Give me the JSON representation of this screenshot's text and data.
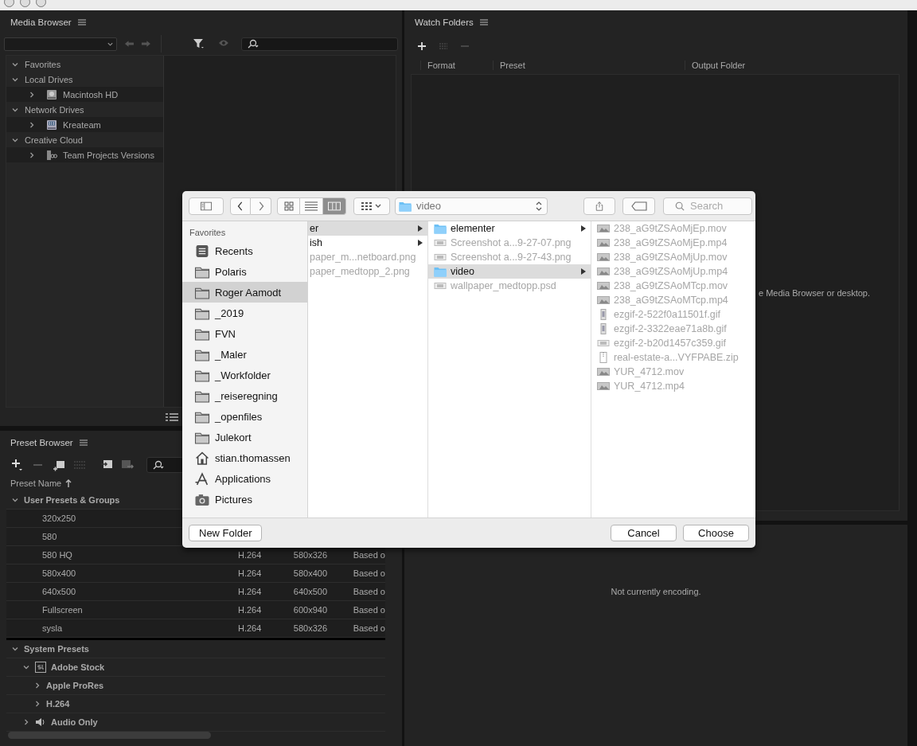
{
  "media_browser": {
    "title": "Media Browser",
    "tree": [
      {
        "label": "Favorites",
        "expanded": true
      },
      {
        "label": "Local Drives",
        "expanded": true,
        "children": [
          {
            "label": "Macintosh HD",
            "kind": "disk",
            "expanded": false
          }
        ]
      },
      {
        "label": "Network Drives",
        "expanded": true,
        "children": [
          {
            "label": "Kreateam",
            "kind": "network",
            "expanded": false
          }
        ]
      },
      {
        "label": "Creative Cloud",
        "expanded": true,
        "children": [
          {
            "label": "Team Projects Versions",
            "kind": "versions",
            "expanded": false
          }
        ]
      }
    ]
  },
  "preset_browser": {
    "title": "Preset Browser",
    "column": "Preset Name",
    "tree": [
      {
        "kind": "group",
        "label": "User Presets & Groups",
        "expanded": true,
        "children": [
          {
            "kind": "preset",
            "name": "320x250"
          },
          {
            "kind": "preset",
            "name": "580"
          },
          {
            "kind": "preset",
            "name": "580 HQ",
            "column_2": "H.264",
            "column_3": "580x326",
            "column_4": "Based o"
          },
          {
            "kind": "preset",
            "name": "580x400",
            "column_2": "H.264",
            "column_3": "580x400",
            "column_4": "Based o"
          },
          {
            "kind": "preset",
            "name": "640x500",
            "column_2": "H.264",
            "column_3": "640x500",
            "column_4": "Based o"
          },
          {
            "kind": "preset",
            "name": "Fullscreen",
            "column_2": "H.264",
            "column_3": "600x940",
            "column_4": "Based o"
          },
          {
            "kind": "preset",
            "name": "sysla",
            "column_2": "H.264",
            "column_3": "580x326",
            "column_4": "Based o"
          }
        ]
      },
      {
        "kind": "group",
        "label": "System Presets",
        "expanded": true,
        "children": [
          {
            "kind": "stock",
            "label": "Adobe Stock",
            "expanded": true,
            "children": [
              {
                "label": "Apple ProRes",
                "expanded": false
              },
              {
                "label": "H.264",
                "expanded": false
              }
            ]
          },
          {
            "kind": "audio",
            "label": "Audio Only",
            "expanded": false
          }
        ]
      }
    ]
  },
  "watch_folders": {
    "title": "Watch Folders",
    "columns": [
      "Format",
      "Preset",
      "Output Folder"
    ],
    "hint": "e Media Browser or desktop."
  },
  "queue": {
    "status": "Not currently encoding."
  },
  "dialog": {
    "view_modes": [
      {
        "kind": "icons",
        "selected": false
      },
      {
        "kind": "list",
        "selected": false
      },
      {
        "kind": "columns",
        "selected": true
      }
    ],
    "path": "video",
    "search": {
      "placeholder": "Search"
    },
    "sidebar": {
      "heading": "Favorites",
      "items": [
        {
          "label": "Recents",
          "kind": "recents",
          "selected": false
        },
        {
          "label": "Polaris",
          "kind": "folder",
          "selected": false
        },
        {
          "label": "Roger Aamodt",
          "kind": "folder",
          "selected": true
        },
        {
          "label": "_2019",
          "kind": "folder",
          "selected": false
        },
        {
          "label": "FVN",
          "kind": "folder",
          "selected": false
        },
        {
          "label": "_Maler",
          "kind": "folder",
          "selected": false
        },
        {
          "label": "_Workfolder",
          "kind": "folder",
          "selected": false
        },
        {
          "label": "_reiseregning",
          "kind": "folder",
          "selected": false
        },
        {
          "label": "_openfiles",
          "kind": "folder",
          "selected": false
        },
        {
          "label": "Julekort",
          "kind": "folder",
          "selected": false
        },
        {
          "label": "stian.thomassen",
          "kind": "home",
          "selected": false
        },
        {
          "label": "Applications",
          "kind": "apps",
          "selected": false
        },
        {
          "label": "Pictures",
          "kind": "pictures",
          "selected": false
        }
      ]
    },
    "columns": [
      {
        "items": [
          {
            "name": "er",
            "selected": true,
            "disabled": false,
            "has_arrow": true
          },
          {
            "name": "ish",
            "selected": false,
            "disabled": false,
            "has_arrow": true
          },
          {
            "name": "paper_m...netboard.png",
            "selected": false,
            "disabled": true,
            "has_arrow": false
          },
          {
            "name": "paper_medtopp_2.png",
            "selected": false,
            "disabled": true,
            "has_arrow": false
          }
        ]
      },
      {
        "items": [
          {
            "name": "elementer",
            "kind": "folder",
            "selected": false,
            "disabled": false,
            "has_arrow": true
          },
          {
            "name": "Screenshot a...9-27-07.png",
            "kind": "image",
            "selected": false,
            "disabled": true,
            "has_arrow": false
          },
          {
            "name": "Screenshot a...9-27-43.png",
            "kind": "image",
            "selected": false,
            "disabled": true,
            "has_arrow": false
          },
          {
            "name": "video",
            "kind": "folder",
            "selected": true,
            "disabled": false,
            "has_arrow": true
          },
          {
            "name": "wallpaper_medtopp.psd",
            "kind": "image",
            "selected": false,
            "disabled": true,
            "has_arrow": false
          }
        ]
      },
      {
        "items": [
          {
            "name": "238_aG9tZSAoMjEp.mov",
            "kind": "video",
            "selected": false,
            "disabled": true,
            "has_arrow": false
          },
          {
            "name": "238_aG9tZSAoMjEp.mp4",
            "kind": "video",
            "selected": false,
            "disabled": true,
            "has_arrow": false
          },
          {
            "name": "238_aG9tZSAoMjUp.mov",
            "kind": "video",
            "selected": false,
            "disabled": true,
            "has_arrow": false
          },
          {
            "name": "238_aG9tZSAoMjUp.mp4",
            "kind": "video",
            "selected": false,
            "disabled": true,
            "has_arrow": false
          },
          {
            "name": "238_aG9tZSAoMTcp.mov",
            "kind": "video",
            "selected": false,
            "disabled": true,
            "has_arrow": false
          },
          {
            "name": "238_aG9tZSAoMTcp.mp4",
            "kind": "video",
            "selected": false,
            "disabled": true,
            "has_arrow": false
          },
          {
            "name": "ezgif-2-522f0a11501f.gif",
            "kind": "gif",
            "selected": false,
            "disabled": true,
            "has_arrow": false
          },
          {
            "name": "ezgif-2-3322eae71a8b.gif",
            "kind": "gif",
            "selected": false,
            "disabled": true,
            "has_arrow": false
          },
          {
            "name": "ezgif-2-b20d1457c359.gif",
            "kind": "image",
            "selected": false,
            "disabled": true,
            "has_arrow": false
          },
          {
            "name": "real-estate-a...VYFPABE.zip",
            "kind": "archive",
            "selected": false,
            "disabled": true,
            "has_arrow": false
          },
          {
            "name": "YUR_4712.mov",
            "kind": "video",
            "selected": false,
            "disabled": true,
            "has_arrow": false
          },
          {
            "name": "YUR_4712.mp4",
            "kind": "video",
            "selected": false,
            "disabled": true,
            "has_arrow": false
          }
        ]
      }
    ],
    "buttons": {
      "new_folder": "New Folder",
      "cancel": "Cancel",
      "choose": "Choose"
    }
  }
}
